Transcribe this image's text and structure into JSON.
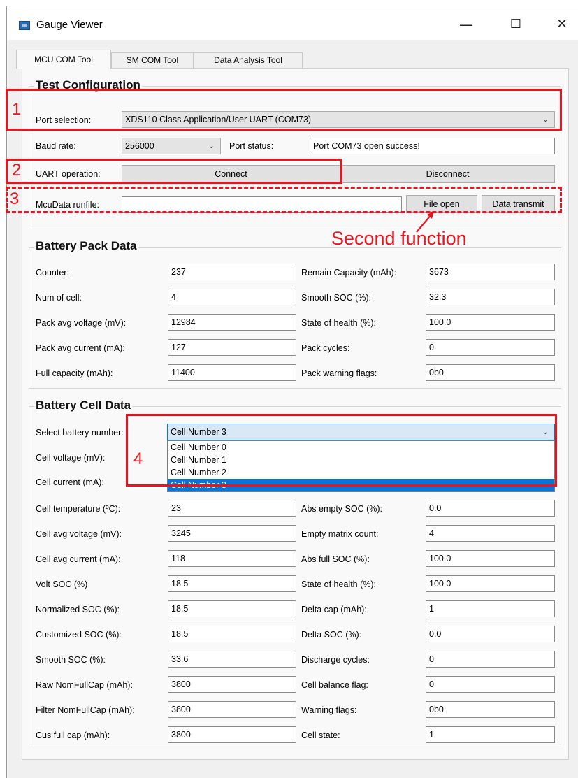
{
  "window": {
    "title": "Gauge Viewer",
    "controls": {
      "minimize": "—",
      "maximize": "☐",
      "close": "✕"
    }
  },
  "tabs": [
    "MCU COM Tool",
    "SM COM Tool",
    "Data Analysis Tool"
  ],
  "active_tab": "MCU COM Tool",
  "test_config": {
    "title": "Test Configuration",
    "port_selection_label": "Port selection:",
    "port_selection_value": "XDS110 Class Application/User UART (COM73)",
    "baud_rate_label": "Baud rate:",
    "baud_rate_value": "256000",
    "port_status_label": "Port status:",
    "port_status_value": "Port COM73 open success!",
    "uart_label": "UART operation:",
    "connect_label": "Connect",
    "disconnect_label": "Disconnect",
    "runfile_label": "McuData runfile:",
    "runfile_value": "",
    "file_open_label": "File open",
    "data_transmit_label": "Data transmit"
  },
  "pack_data": {
    "title": "Battery Pack Data",
    "left": [
      {
        "label": "Counter:",
        "value": "237"
      },
      {
        "label": "Num of cell:",
        "value": "4"
      },
      {
        "label": "Pack avg voltage (mV):",
        "value": "12984"
      },
      {
        "label": "Pack avg current (mA):",
        "value": "127"
      },
      {
        "label": "Full capacity (mAh):",
        "value": "11400"
      }
    ],
    "right": [
      {
        "label": "Remain Capacity (mAh):",
        "value": "3673"
      },
      {
        "label": "Smooth SOC (%):",
        "value": "32.3"
      },
      {
        "label": "State of health (%):",
        "value": "100.0"
      },
      {
        "label": "Pack cycles:",
        "value": "0"
      },
      {
        "label": "Pack warning flags:",
        "value": "0b0"
      }
    ]
  },
  "cell_data": {
    "title": "Battery Cell Data",
    "select_label": "Select battery number:",
    "select_value": "Cell Number 3",
    "dropdown_options": [
      "Cell Number 0",
      "Cell Number 1",
      "Cell Number 2",
      "Cell Number 3"
    ],
    "cell_voltage_label": "Cell voltage (mV):",
    "cell_current_label": "Cell current (mA):",
    "left": [
      {
        "label": "Cell temperature (ºC):",
        "value": "23"
      },
      {
        "label": "Cell avg voltage (mV):",
        "value": "3245"
      },
      {
        "label": "Cell avg current (mA):",
        "value": "118"
      },
      {
        "label": "Volt SOC (%)",
        "value": "18.5"
      },
      {
        "label": "Normalized SOC (%):",
        "value": "18.5"
      },
      {
        "label": "Customized SOC (%):",
        "value": "18.5"
      },
      {
        "label": "Smooth SOC (%):",
        "value": "33.6"
      },
      {
        "label": "Raw NomFullCap (mAh):",
        "value": "3800"
      },
      {
        "label": "Filter NomFullCap (mAh):",
        "value": "3800"
      },
      {
        "label": "Cus full cap (mAh):",
        "value": "3800"
      }
    ],
    "right": [
      {
        "label": "Abs empty SOC (%):",
        "value": "0.0"
      },
      {
        "label": "Empty matrix count:",
        "value": "4"
      },
      {
        "label": "Abs full SOC (%):",
        "value": "100.0"
      },
      {
        "label": "State of health (%):",
        "value": "100.0"
      },
      {
        "label": "Delta cap (mAh):",
        "value": "1"
      },
      {
        "label": "Delta SOC (%):",
        "value": "0.0"
      },
      {
        "label": "Discharge cycles:",
        "value": "0"
      },
      {
        "label": "Cell balance flag:",
        "value": "0"
      },
      {
        "label": "Warning flags:",
        "value": "0b0"
      },
      {
        "label": "Cell state:",
        "value": "1"
      }
    ]
  },
  "annotations": {
    "n1": "1",
    "n2": "2",
    "n3": "3",
    "n4": "4",
    "second_function": "Second function",
    "color": "#e8141e"
  },
  "colors": {
    "dropdown_selected": "#0a74d4",
    "window_bg": "#f0f0f0"
  },
  "icons": {
    "app": "gauge-viewer-app-icon",
    "combo_arrow": "chevron-down-icon"
  }
}
